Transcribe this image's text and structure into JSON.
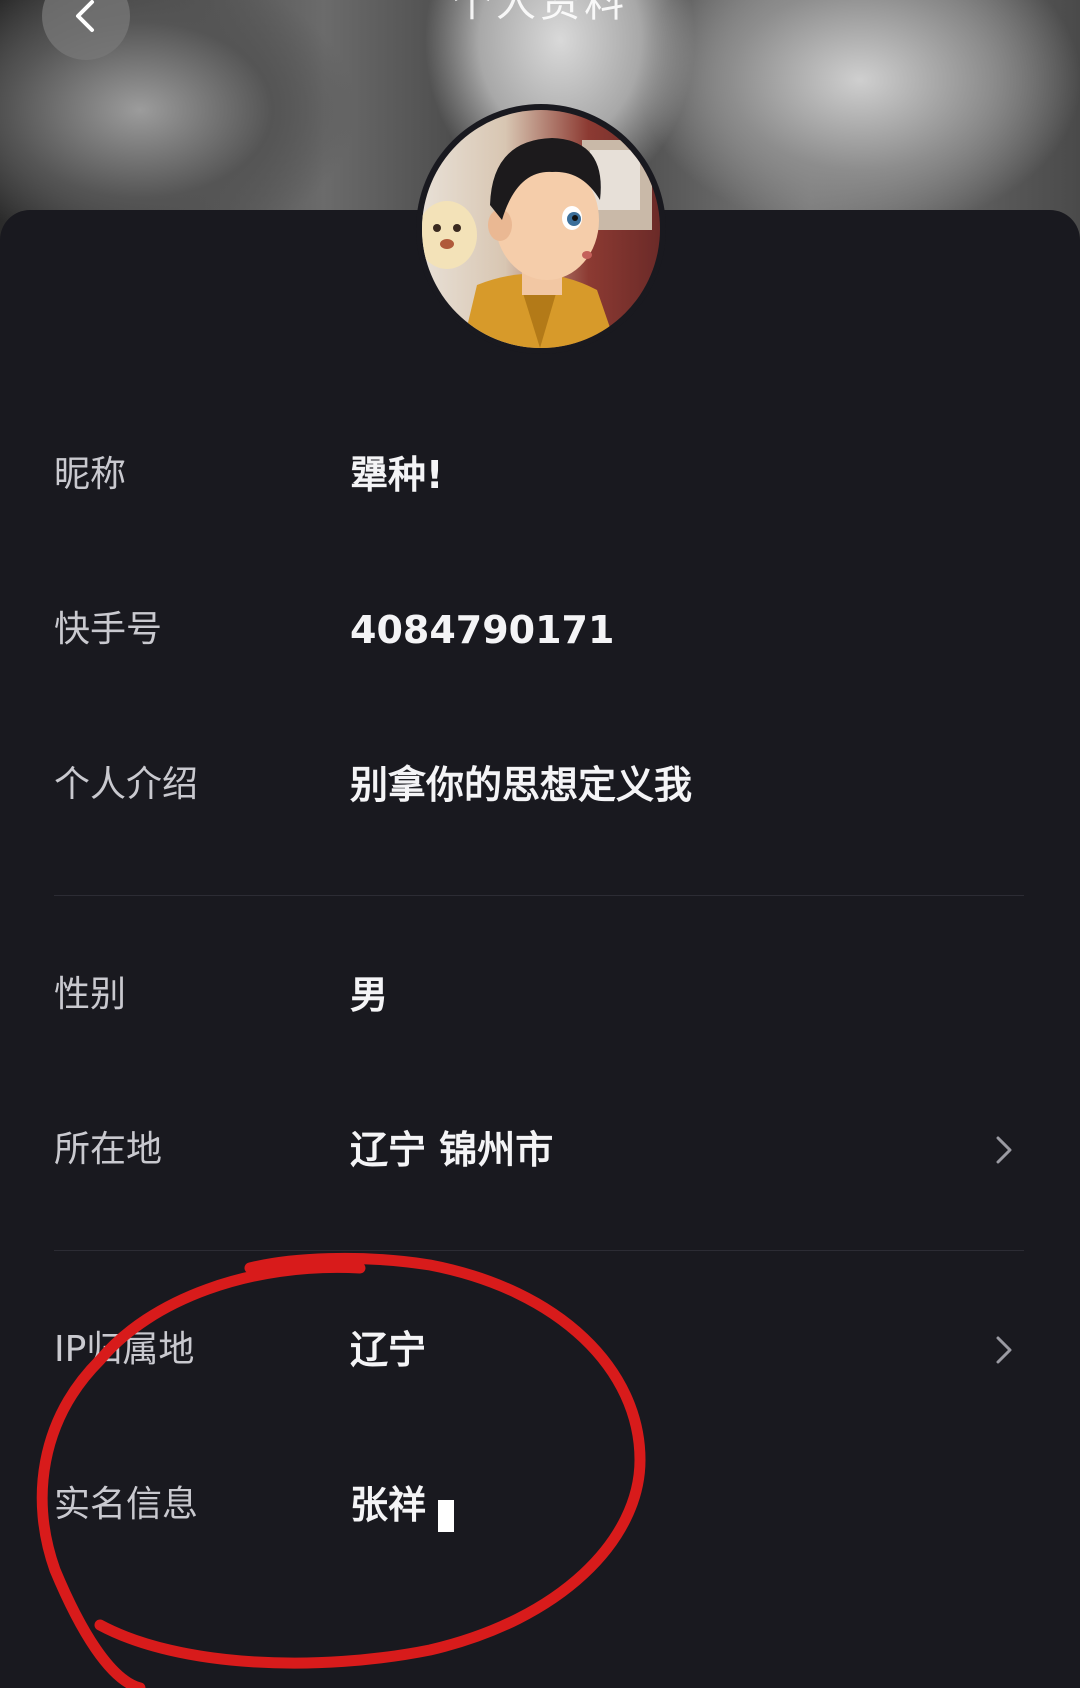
{
  "header": {
    "title": "个人资料",
    "back_icon": "chevron-left-icon"
  },
  "profile": {
    "avatar": "avatar-photo",
    "rows": [
      {
        "label": "昵称",
        "value": "犟种!"
      },
      {
        "label": "快手号",
        "value": "4084790171"
      },
      {
        "label": "个人介绍",
        "value": "别拿你的思想定义我"
      },
      {
        "label": "性别",
        "value": "男"
      },
      {
        "label": "所在地",
        "value": "辽宁 锦州市",
        "chevron": "chevron-right-icon"
      },
      {
        "label": "IP归属地",
        "value": "辽宁",
        "chevron": "chevron-right-icon"
      },
      {
        "label": "实名信息",
        "value": "张祥"
      }
    ]
  },
  "annotation": {
    "color": "#d81b1b",
    "shape": "hand-drawn-circle"
  }
}
